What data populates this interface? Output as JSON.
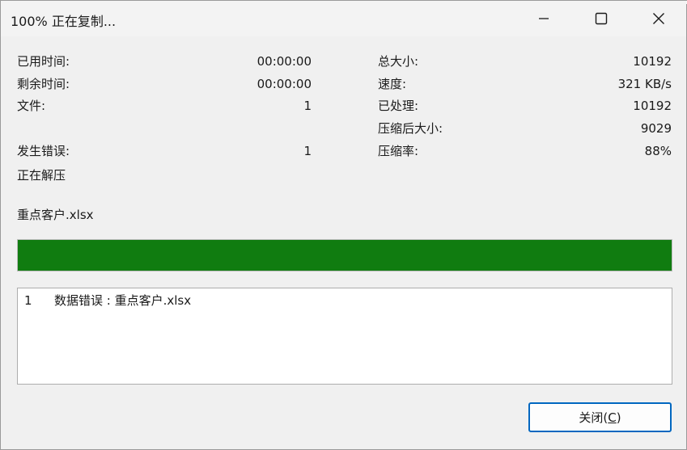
{
  "window": {
    "title": "100% 正在复制..."
  },
  "stats_left": {
    "elapsed_label": "已用时间:",
    "elapsed_value": "00:00:00",
    "remaining_label": "剩余时间:",
    "remaining_value": "00:00:00",
    "files_label": "文件:",
    "files_value": "1",
    "errors_label": "发生错误:",
    "errors_value": "1",
    "status_text": "正在解压"
  },
  "stats_right": {
    "total_size_label": "总大小:",
    "total_size_value": "10192",
    "speed_label": "速度:",
    "speed_value": "321 KB/s",
    "processed_label": "已处理:",
    "processed_value": "10192",
    "compressed_size_label": "压缩后大小:",
    "compressed_size_value": "9029",
    "ratio_label": "压缩率:",
    "ratio_value": "88%"
  },
  "current_file": "重点客户.xlsx",
  "progress": {
    "percent": 100,
    "color": "#107c10"
  },
  "log": {
    "entries": [
      {
        "index": "1",
        "text": "数据错误 : 重点客户.xlsx"
      }
    ]
  },
  "buttons": {
    "close_label": "关闭(",
    "close_mnemonic": "C",
    "close_label_end": ")"
  },
  "titlebar_icons": {
    "minimize": "minimize-icon",
    "maximize": "maximize-icon",
    "close": "close-icon"
  }
}
